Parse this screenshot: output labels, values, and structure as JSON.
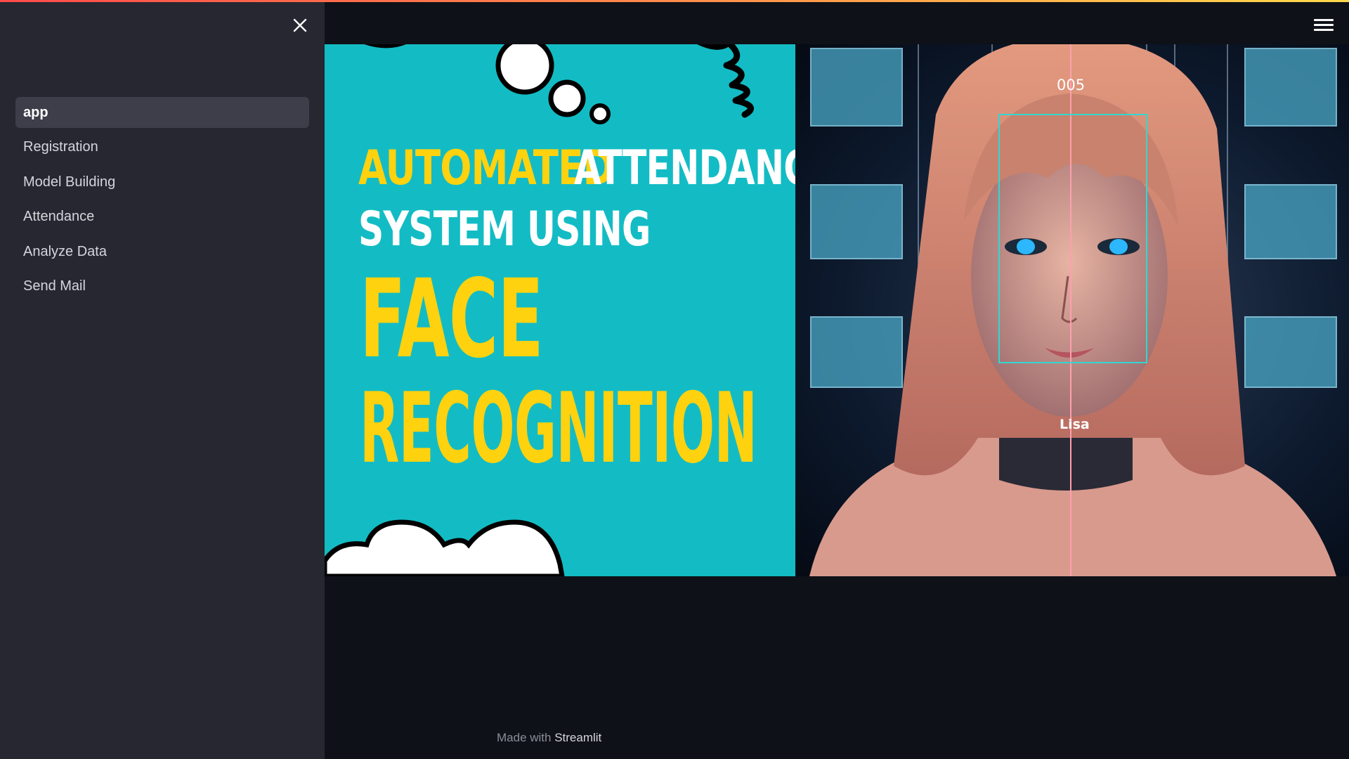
{
  "sidebar": {
    "items": [
      {
        "label": "app",
        "active": true
      },
      {
        "label": "Registration"
      },
      {
        "label": "Model Building"
      },
      {
        "label": "Attendance"
      },
      {
        "label": "Analyze Data"
      },
      {
        "label": "Send Mail"
      }
    ]
  },
  "hero": {
    "line1_a": "AUTOMATED",
    "line1_b": "ATTENDANCE",
    "line2": "SYSTEM USING",
    "line3": "FACE",
    "line4": "RECOGNITION",
    "face_id": "005",
    "face_name": "Lisa"
  },
  "footer": {
    "prefix": "Made with ",
    "brand": "Streamlit"
  },
  "colors": {
    "sidebar_bg": "#262730",
    "main_bg": "#0e1117",
    "hero_teal": "#13bcc4",
    "hero_yellow": "#ffd20f",
    "accent": "#ff4b4b"
  },
  "icons": {
    "close": "close-icon",
    "menu": "hamburger-menu-icon"
  }
}
